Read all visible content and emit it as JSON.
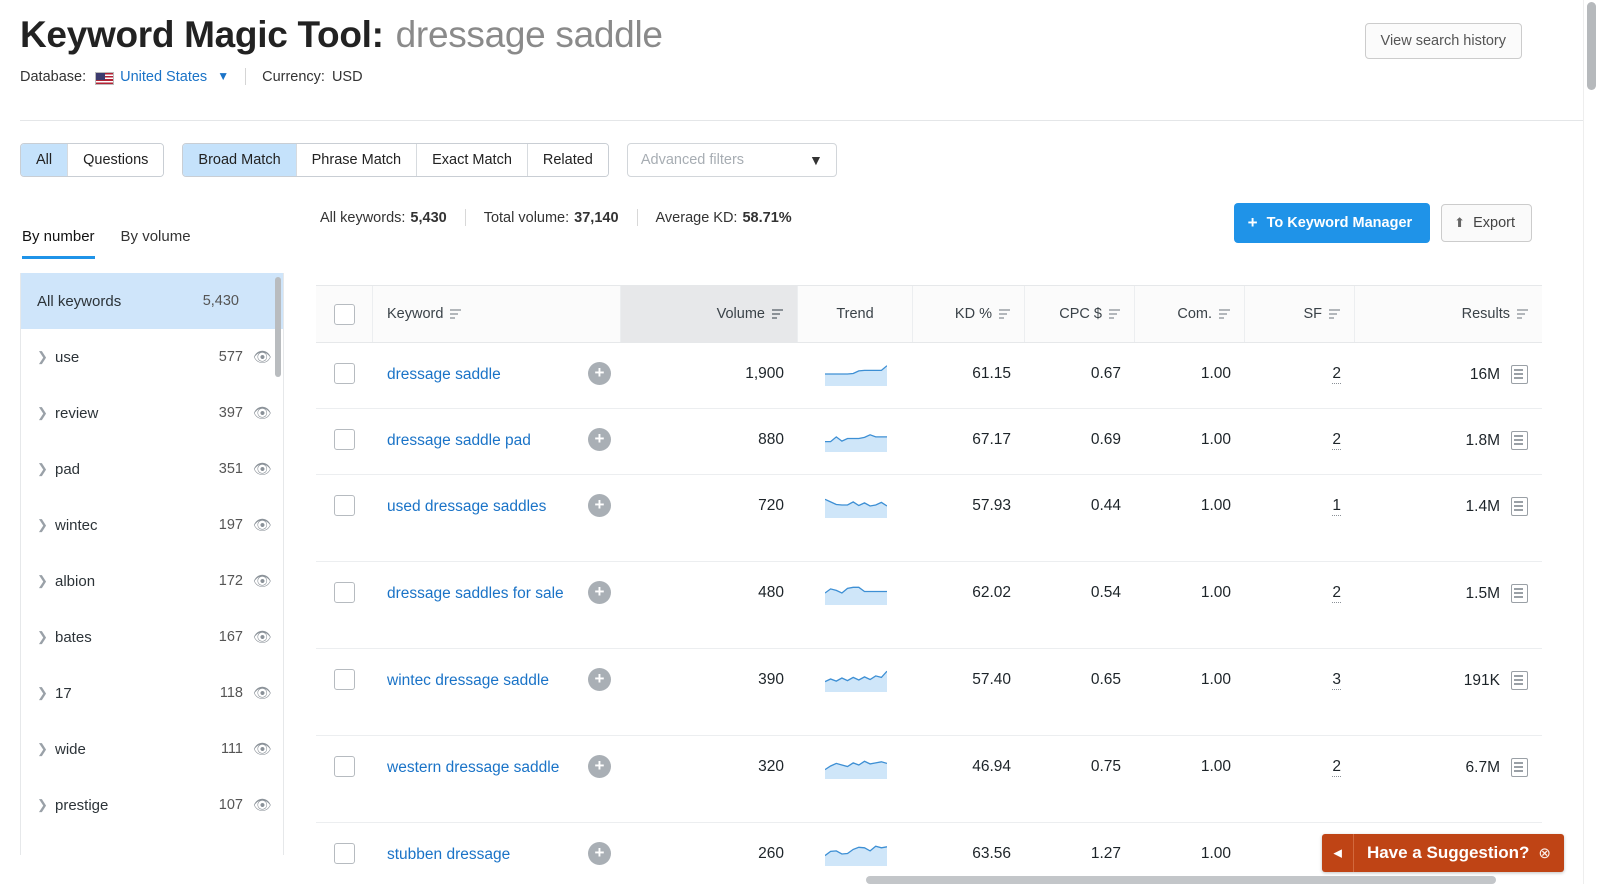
{
  "header": {
    "title_main": "Keyword Magic Tool:",
    "title_term": "dressage saddle",
    "database_label": "Database:",
    "database_value": "United States",
    "currency_label": "Currency:",
    "currency_value": "USD",
    "history_button": "View search history"
  },
  "filters": {
    "type_group": [
      {
        "label": "All",
        "active": true
      },
      {
        "label": "Questions",
        "active": false
      }
    ],
    "match_group": [
      {
        "label": "Broad Match",
        "active": true
      },
      {
        "label": "Phrase Match",
        "active": false
      },
      {
        "label": "Exact Match",
        "active": false
      },
      {
        "label": "Related",
        "active": false
      }
    ],
    "advanced_placeholder": "Advanced filters"
  },
  "stats": {
    "all_keywords_label": "All keywords:",
    "all_keywords_value": "5,430",
    "total_volume_label": "Total volume:",
    "total_volume_value": "37,140",
    "average_kd_label": "Average KD:",
    "average_kd_value": "58.71%"
  },
  "actions": {
    "keyword_manager": "To Keyword Manager",
    "keyword_manager_plus": "+",
    "export": "Export"
  },
  "sidebar": {
    "tabs": [
      {
        "label": "By number",
        "active": true
      },
      {
        "label": "By volume",
        "active": false
      }
    ],
    "all_keywords": {
      "label": "All keywords",
      "count": "5,430"
    },
    "items": [
      {
        "label": "use",
        "count": "577"
      },
      {
        "label": "review",
        "count": "397"
      },
      {
        "label": "pad",
        "count": "351"
      },
      {
        "label": "wintec",
        "count": "197"
      },
      {
        "label": "albion",
        "count": "172"
      },
      {
        "label": "bates",
        "count": "167"
      },
      {
        "label": "17",
        "count": "118"
      },
      {
        "label": "wide",
        "count": "111"
      },
      {
        "label": "prestige",
        "count": "107"
      }
    ]
  },
  "table": {
    "columns": [
      {
        "key": "keyword",
        "label": "Keyword",
        "sortable": true,
        "sorted": false
      },
      {
        "key": "volume",
        "label": "Volume",
        "sortable": true,
        "sorted": true
      },
      {
        "key": "trend",
        "label": "Trend",
        "sortable": false,
        "sorted": false
      },
      {
        "key": "kd",
        "label": "KD %",
        "sortable": true,
        "sorted": false
      },
      {
        "key": "cpc",
        "label": "CPC $",
        "sortable": true,
        "sorted": false
      },
      {
        "key": "com",
        "label": "Com.",
        "sortable": true,
        "sorted": false
      },
      {
        "key": "sf",
        "label": "SF",
        "sortable": true,
        "sorted": false
      },
      {
        "key": "results",
        "label": "Results",
        "sortable": true,
        "sorted": false
      }
    ],
    "rows": [
      {
        "keyword": "dressage saddle",
        "volume": "1,900",
        "kd": "61.15",
        "cpc": "0.67",
        "com": "1.00",
        "sf": "2",
        "results": "16M",
        "lines": 1,
        "trend": [
          0.46,
          0.46,
          0.46,
          0.46,
          0.46,
          0.48,
          0.58,
          0.6,
          0.6,
          0.6,
          0.6,
          0.78
        ]
      },
      {
        "keyword": "dressage saddle pad",
        "volume": "880",
        "kd": "67.17",
        "cpc": "0.69",
        "com": "1.00",
        "sf": "2",
        "results": "1.8M",
        "lines": 1,
        "trend": [
          0.4,
          0.4,
          0.58,
          0.42,
          0.52,
          0.52,
          0.52,
          0.56,
          0.66,
          0.58,
          0.58,
          0.58
        ]
      },
      {
        "keyword": "used dressage saddles",
        "volume": "720",
        "kd": "57.93",
        "cpc": "0.44",
        "com": "1.00",
        "sf": "1",
        "results": "1.4M",
        "lines": 2,
        "trend": [
          0.72,
          0.62,
          0.52,
          0.5,
          0.5,
          0.62,
          0.48,
          0.58,
          0.46,
          0.5,
          0.6,
          0.46
        ]
      },
      {
        "keyword": "dressage saddles for sale",
        "volume": "480",
        "kd": "62.02",
        "cpc": "0.54",
        "com": "1.00",
        "sf": "2",
        "results": "1.5M",
        "lines": 2,
        "trend": [
          0.46,
          0.62,
          0.56,
          0.46,
          0.64,
          0.68,
          0.68,
          0.52,
          0.52,
          0.52,
          0.52,
          0.52
        ]
      },
      {
        "keyword": "wintec dressage saddle",
        "volume": "390",
        "kd": "57.40",
        "cpc": "0.65",
        "com": "1.00",
        "sf": "3",
        "results": "191K",
        "lines": 2,
        "trend": [
          0.4,
          0.5,
          0.42,
          0.54,
          0.44,
          0.56,
          0.46,
          0.58,
          0.48,
          0.62,
          0.56,
          0.8
        ]
      },
      {
        "keyword": "western dressage saddle",
        "volume": "320",
        "kd": "46.94",
        "cpc": "0.75",
        "com": "1.00",
        "sf": "2",
        "results": "6.7M",
        "lines": 2,
        "trend": [
          0.36,
          0.5,
          0.6,
          0.54,
          0.48,
          0.62,
          0.54,
          0.68,
          0.58,
          0.62,
          0.66,
          0.6
        ]
      },
      {
        "keyword": "stubben dressage",
        "volume": "260",
        "kd": "63.56",
        "cpc": "1.27",
        "com": "1.00",
        "sf": "",
        "results": "",
        "lines": 1,
        "trend": [
          0.4,
          0.56,
          0.58,
          0.46,
          0.48,
          0.64,
          0.72,
          0.7,
          0.58,
          0.76,
          0.7,
          0.74
        ]
      }
    ]
  },
  "suggestion": {
    "text": "Have a Suggestion?",
    "megaphone": "◂",
    "close": "⊗"
  },
  "colors": {
    "accent_blue": "#1f93e8",
    "link_blue": "#1a73c7",
    "highlight": "#cfe5fa",
    "suggest_orange": "#bf4415"
  }
}
